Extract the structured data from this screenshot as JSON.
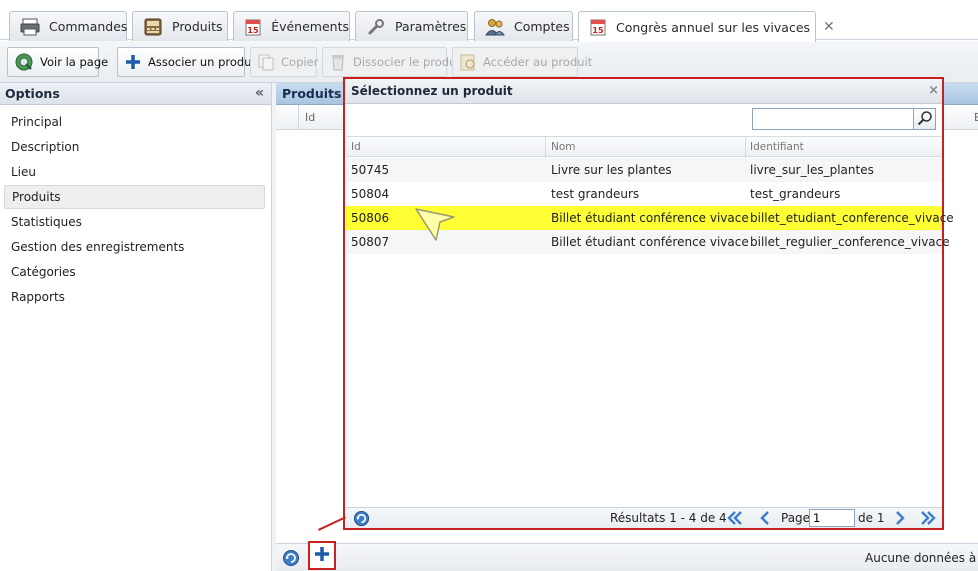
{
  "tabs": [
    {
      "label": "Commandes",
      "icon": "printer-icon"
    },
    {
      "label": "Produits",
      "icon": "register-icon"
    },
    {
      "label": "Événements",
      "icon": "calendar-icon"
    },
    {
      "label": "Paramètres",
      "icon": "wrench-icon"
    },
    {
      "label": "Comptes",
      "icon": "users-icon"
    },
    {
      "label": "Congrès annuel sur les vivaces",
      "icon": "calendar-icon",
      "active": true,
      "closable": true
    }
  ],
  "toolbar": {
    "view_page": "Voir la page",
    "associate_product": "Associer un produit",
    "copy": "Copier",
    "dissociate_product": "Dissocier le produit",
    "access_product": "Accéder au produit"
  },
  "sidebar": {
    "title": "Options",
    "collapse_glyph": "«",
    "items": [
      {
        "label": "Principal"
      },
      {
        "label": "Description"
      },
      {
        "label": "Lieu"
      },
      {
        "label": "Produits",
        "selected": true
      },
      {
        "label": "Statistiques"
      },
      {
        "label": "Gestion des enregistrements"
      },
      {
        "label": "Catégories"
      },
      {
        "label": "Rapports"
      }
    ]
  },
  "main": {
    "title": "Produits",
    "columns": {
      "id": "Id",
      "e": "E"
    },
    "footer_status": "Aucune données à af"
  },
  "dialog": {
    "title": "Sélectionnez un produit",
    "close_glyph": "×",
    "search": {
      "value": "",
      "placeholder": ""
    },
    "columns": {
      "id": "Id",
      "name": "Nom",
      "identifier": "Identifiant"
    },
    "rows": [
      {
        "id": "50745",
        "name": "Livre sur les plantes",
        "identifier": "livre_sur_les_plantes"
      },
      {
        "id": "50804",
        "name": "test grandeurs",
        "identifier": "test_grandeurs"
      },
      {
        "id": "50806",
        "name": "Billet étudiant conférence vivace",
        "identifier": "billet_etudiant_conference_vivace",
        "highlighted": true
      },
      {
        "id": "50807",
        "name": "Billet étudiant conférence vivace",
        "identifier": "billet_regulier_conference_vivace"
      }
    ],
    "footer": {
      "results": "Résultats 1 - 4 de 4",
      "page_label": "Page",
      "page_value": "1",
      "page_of": "de 1"
    }
  },
  "colors": {
    "highlight_row": "#ffff33",
    "annotation_red": "#c81f1f",
    "header_blue": "#a9c4e2",
    "pointer_yellow": "#ffffa8"
  }
}
